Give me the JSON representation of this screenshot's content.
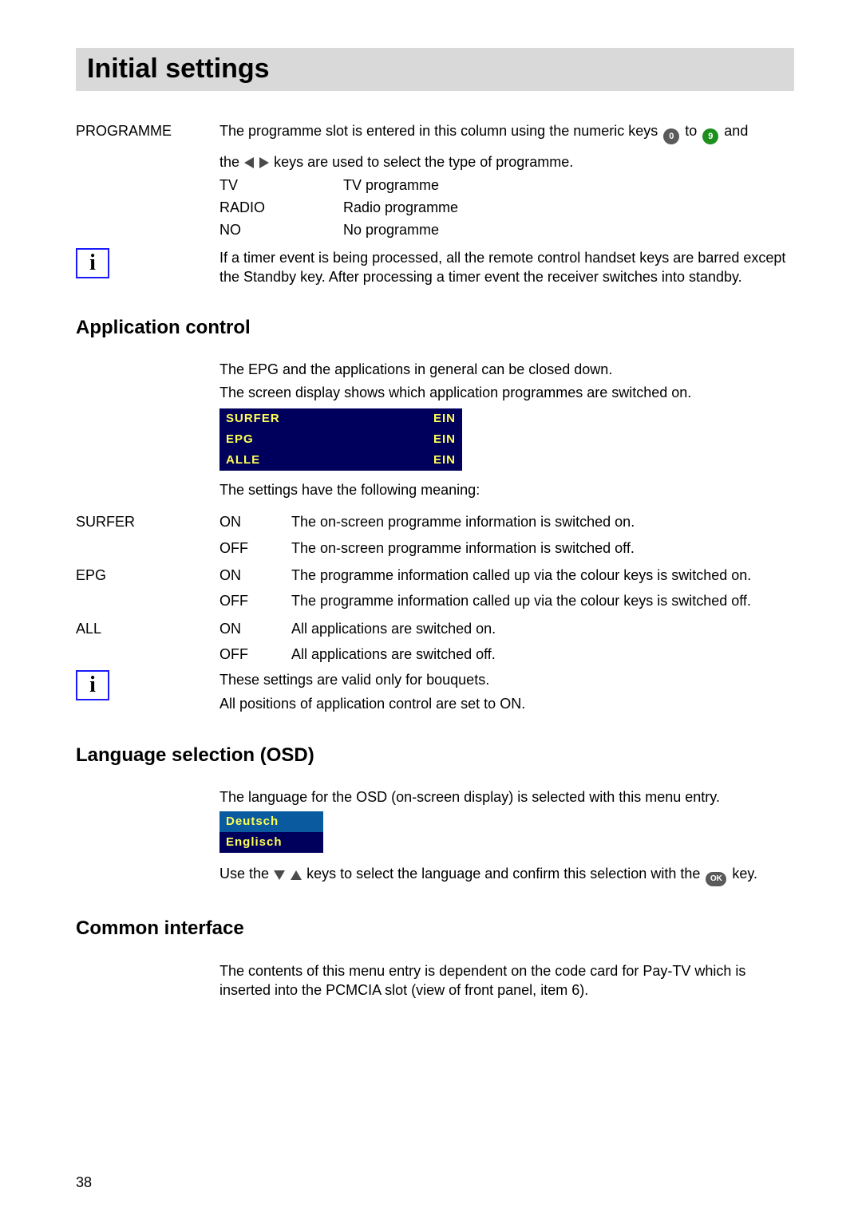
{
  "title": "Initial settings",
  "programme": {
    "label": "PROGRAMME",
    "intro_1a": "The programme slot is entered in this column using the numeric keys ",
    "intro_1b": " to ",
    "intro_1c": " and",
    "intro_2a": "the ",
    "intro_2b": " keys are used to select the type of programme.",
    "defs": [
      {
        "key": "TV",
        "val": "TV programme"
      },
      {
        "key": "RADIO",
        "val": "Radio programme"
      },
      {
        "key": "NO",
        "val": "No programme"
      }
    ],
    "key0": "0",
    "key9": "9",
    "info_note": "If a timer event is being processed, all the remote control handset keys are barred except the Standby key. After processing a timer event the receiver switches into standby."
  },
  "app_control": {
    "heading": "Application control",
    "line1": "The EPG and the applications in general can be closed down.",
    "line2": "The screen display shows which application programmes are switched on.",
    "osd": [
      {
        "name": "SURFER",
        "state": "EIN"
      },
      {
        "name": "EPG",
        "state": "EIN"
      },
      {
        "name": "ALLE",
        "state": "EIN"
      }
    ],
    "meaning_intro": "The settings have the following meaning:",
    "items": [
      {
        "label": "SURFER",
        "states": [
          {
            "s": "ON",
            "d": "The on-screen programme information is switched on."
          },
          {
            "s": "OFF",
            "d": "The on-screen programme information is switched off."
          }
        ]
      },
      {
        "label": "EPG",
        "states": [
          {
            "s": "ON",
            "d": "The programme information called up via the colour keys is switched on."
          },
          {
            "s": "OFF",
            "d": "The programme information called up via the colour keys is switched off."
          }
        ]
      },
      {
        "label": "ALL",
        "states": [
          {
            "s": "ON",
            "d": "All applications are switched on."
          },
          {
            "s": "OFF",
            "d": "All applications are switched off."
          }
        ]
      }
    ],
    "info_note1": "These settings are valid only for bouquets.",
    "info_note2": "All positions of application control are set to ON."
  },
  "language": {
    "heading": "Language selection (OSD)",
    "intro": "The language for the OSD (on-screen display) is selected with this menu entry.",
    "osd": [
      "Deutsch",
      "Englisch"
    ],
    "use_a": "Use the ",
    "use_b": " keys to select the language and confirm this selection with the ",
    "use_c": " key.",
    "ok_label": "OK"
  },
  "common_if": {
    "heading": "Common interface",
    "text": "The contents of this menu entry is dependent on the code card for Pay-TV which is inserted into the PCMCIA slot (view of front panel, item 6)."
  },
  "page_number": "38"
}
